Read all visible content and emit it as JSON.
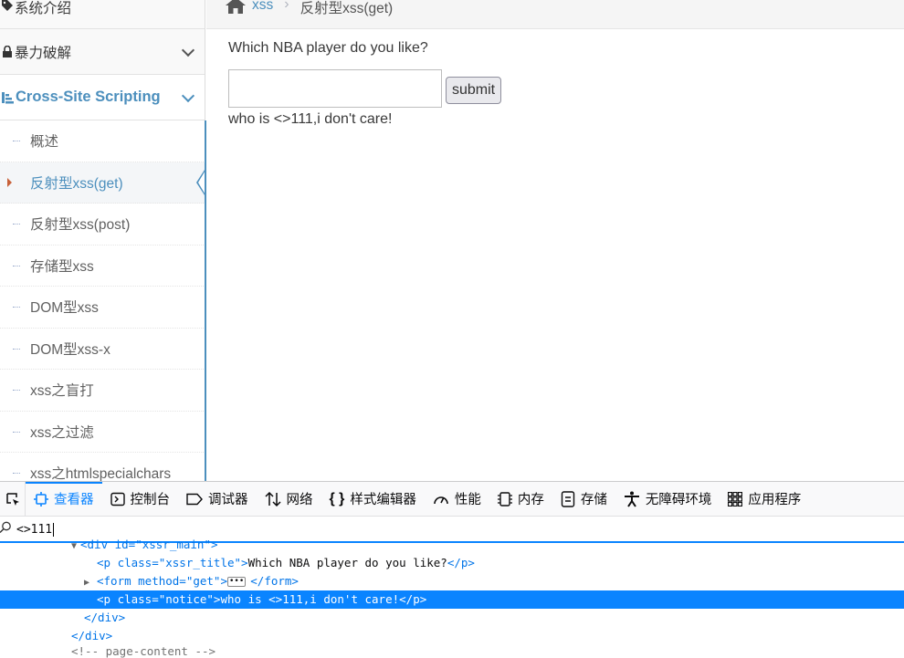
{
  "sidebar": {
    "top_item": "系统介绍",
    "brute": "暴力破解",
    "xss": "Cross-Site Scripting",
    "xss_items": [
      "概述",
      "反射型xss(get)",
      "反射型xss(post)",
      "存储型xss",
      "DOM型xss",
      "DOM型xss-x",
      "xss之盲打",
      "xss之过滤",
      "xss之htmlspecialchars"
    ],
    "active_index": 1
  },
  "breadcrumb": {
    "link": "xss",
    "current": "反射型xss(get)"
  },
  "main": {
    "title": "Which NBA player do you like?",
    "input_value": "",
    "submit_label": "submit",
    "notice": "who is <>111,i don't care!"
  },
  "devtools": {
    "tabs": [
      "查看器",
      "控制台",
      "调试器",
      "网络",
      "样式编辑器",
      "性能",
      "内存",
      "存储",
      "无障碍环境",
      "应用程序"
    ],
    "selected_tab": "查看器",
    "search_value": "<>111",
    "tree": {
      "l0_tag": "<div id=\"xssr_main\">",
      "l1_open": "<p class=\"xssr_title\">",
      "l1_text": "Which NBA player do you like?",
      "l1_close": "</p>",
      "l2_open": "<form method=\"get\">",
      "l2_close": "</form>",
      "l3_open": "<p class=\"notice\">",
      "l3_text": "who is <>111,i don't care!",
      "l3_close": "</p>",
      "l4": "</div>",
      "l5": "</div>",
      "l6": "<!-- page-content -->"
    }
  },
  "colors": {
    "accent": "#4c8fbd",
    "devtools_blue": "#0a84ff",
    "active_arrow": "#c86139"
  }
}
